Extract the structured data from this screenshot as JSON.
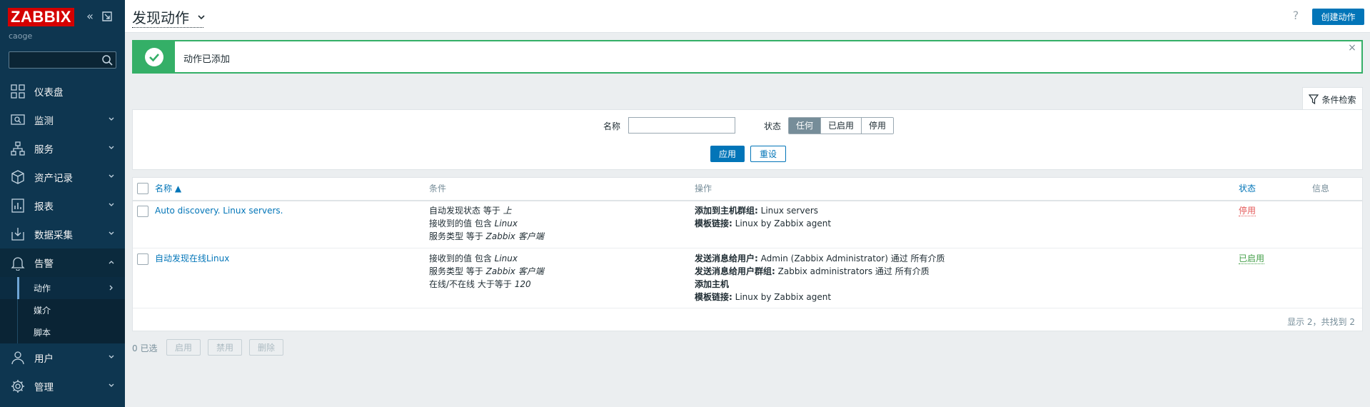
{
  "sidebar": {
    "logo": "ZABBIX",
    "server_name": "caoge",
    "search_placeholder": "",
    "menu": [
      {
        "label": "仪表盘",
        "icon": "dashboard-icon",
        "has_sub": false
      },
      {
        "label": "监测",
        "icon": "monitoring-icon",
        "has_sub": true
      },
      {
        "label": "服务",
        "icon": "services-icon",
        "has_sub": true
      },
      {
        "label": "资产记录",
        "icon": "inventory-icon",
        "has_sub": true
      },
      {
        "label": "报表",
        "icon": "reports-icon",
        "has_sub": true
      },
      {
        "label": "数据采集",
        "icon": "data-collection-icon",
        "has_sub": true
      },
      {
        "label": "告警",
        "icon": "alerts-icon",
        "has_sub": true,
        "expanded": true
      },
      {
        "label": "用户",
        "icon": "users-icon",
        "has_sub": true
      },
      {
        "label": "管理",
        "icon": "administration-icon",
        "has_sub": true
      }
    ],
    "alerts_submenu": [
      {
        "label": "动作",
        "current": true
      },
      {
        "label": "媒介"
      },
      {
        "label": "脚本"
      }
    ]
  },
  "header": {
    "title": "发现动作",
    "help": "?",
    "create_button": "创建动作"
  },
  "message": {
    "text": "动作已添加",
    "close": "×"
  },
  "filter": {
    "tab_label": "条件检索",
    "name_label": "名称",
    "name_value": "",
    "status_label": "状态",
    "status_options": [
      "任何",
      "已启用",
      "停用"
    ],
    "status_selected": "任何",
    "apply": "应用",
    "reset": "重设"
  },
  "table": {
    "headers": {
      "name": "名称 ▲",
      "conditions": "条件",
      "operations": "操作",
      "status": "状态",
      "info": "信息"
    },
    "rows": [
      {
        "name": "Auto discovery. Linux servers.",
        "conditions": [
          {
            "text": "自动发现状态 等于 ",
            "value": "上"
          },
          {
            "text": "接收到的值 包含 ",
            "value": "Linux"
          },
          {
            "text": "服务类型 等于 ",
            "value": "Zabbix 客户端"
          }
        ],
        "operations": [
          {
            "bold": "添加到主机群组:",
            "text": " Linux servers"
          },
          {
            "bold": "模板链接:",
            "text": " Linux by Zabbix agent"
          }
        ],
        "status": "停用"
      },
      {
        "name": "自动发现在线Linux",
        "conditions": [
          {
            "text": "接收到的值 包含 ",
            "value": "Linux"
          },
          {
            "text": "服务类型 等于 ",
            "value": "Zabbix 客户端"
          },
          {
            "text": "在线/不在线 大于等于 ",
            "value": "120"
          }
        ],
        "operations": [
          {
            "bold": "发送消息给用户:",
            "text": " Admin (Zabbix Administrator) 通过 所有介质"
          },
          {
            "bold": "发送消息给用户群组:",
            "text": " Zabbix administrators 通过 所有介质"
          },
          {
            "bold": "添加主机",
            "text": ""
          },
          {
            "bold": "模板链接:",
            "text": " Linux by Zabbix agent"
          }
        ],
        "status": "已启用"
      }
    ],
    "footer": "显示 2，共找到 2"
  },
  "bulk": {
    "selected": "0 已选",
    "enable": "启用",
    "disable": "禁用",
    "delete": "删除"
  }
}
